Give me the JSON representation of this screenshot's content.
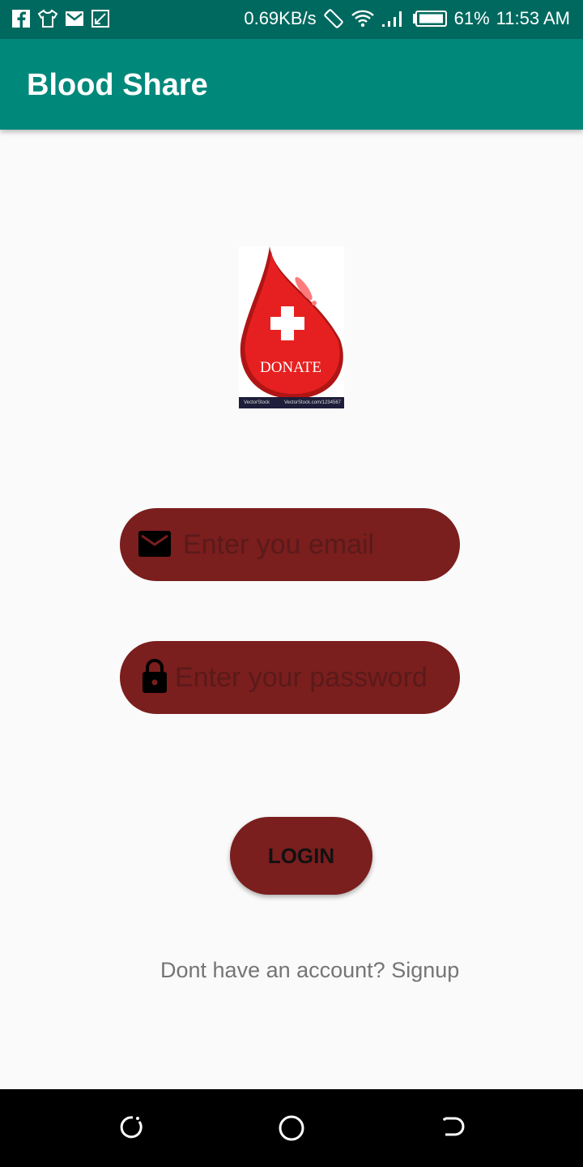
{
  "status_bar": {
    "net_speed": "0.69KB/s",
    "battery": "61%",
    "time": "11:53 AM",
    "left_icons": [
      "facebook-icon",
      "tshirt-icon",
      "mail-icon",
      "screenshot-icon"
    ],
    "right_icons": [
      "rotation-lock-icon",
      "wifi-icon",
      "signal-icon",
      "battery-icon"
    ]
  },
  "app_bar": {
    "title": "Blood Share"
  },
  "logo": {
    "text": "DONATE",
    "stock_left": "VectorStock",
    "stock_right": "VectorStock.com/1234567"
  },
  "form": {
    "email": {
      "placeholder": "Enter you email",
      "value": "",
      "icon": "mail-icon"
    },
    "password": {
      "placeholder": "Enter your password",
      "value": "",
      "icon": "lock-icon"
    }
  },
  "login_button": {
    "label": "LOGIN"
  },
  "signup_link": {
    "text": "Dont have an account? Signup"
  },
  "nav_bar": {
    "icons": [
      "back-icon",
      "home-icon",
      "recent-apps-icon"
    ]
  },
  "colors": {
    "status_bar": "#00695f",
    "app_bar": "#00887a",
    "field_bg": "#7b1e1e",
    "blood_red": "#e62020"
  }
}
